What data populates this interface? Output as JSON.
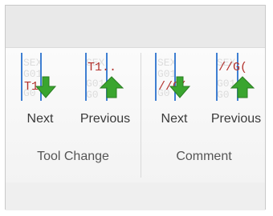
{
  "groups": [
    {
      "label": "Tool Change",
      "buttons": [
        {
          "label": "Next",
          "icon_text": "T1..",
          "icon": "arrow-down-icon"
        },
        {
          "label": "Previous",
          "icon_text": "T1..",
          "icon": "arrow-up-icon"
        }
      ]
    },
    {
      "label": "Comment",
      "buttons": [
        {
          "label": "Next",
          "icon_text": "//G(",
          "icon": "arrow-down-icon"
        },
        {
          "label": "Previous",
          "icon_text": "//G(",
          "icon": "arrow-up-icon"
        }
      ]
    }
  ],
  "colors": {
    "arrow_green": "#3aa52f",
    "icon_blue": "#3f7fd2",
    "icon_red": "#b3332e"
  }
}
